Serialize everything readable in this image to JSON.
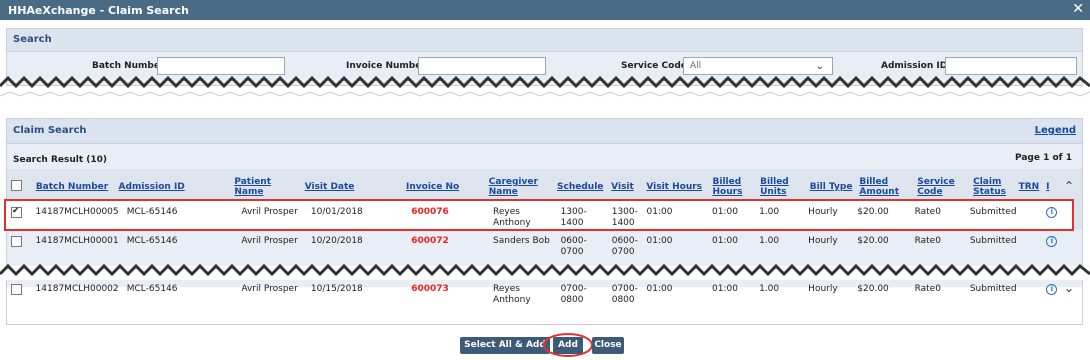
{
  "window": {
    "title": "HHAeXchange - Claim Search",
    "close_label": "✕"
  },
  "search_panel": {
    "title": "Search",
    "batch_label": "Batch Number:",
    "invoice_label": "Invoice Number:",
    "service_code_label": "Service Code:",
    "service_code_value": "All",
    "admission_label": "Admission ID:"
  },
  "results_panel": {
    "title": "Claim Search",
    "legend_link": "Legend",
    "result_count": "Search Result (10)",
    "page_info": "Page 1 of 1"
  },
  "columns": [
    "Batch Number",
    "Admission ID",
    "Patient Name",
    "Visit Date",
    "Invoice No",
    "Caregiver Name",
    "Schedule",
    "Visit",
    "Visit Hours",
    "Billed Hours",
    "Billed Units",
    "Bill Type",
    "Billed Amount",
    "Service Code",
    "Claim Status",
    "TRN",
    "I"
  ],
  "rows": [
    {
      "checked": true,
      "batch": "14187MCLH00005",
      "admission": "MCL-65146",
      "patient": "Avril Prosper",
      "date": "10/01/2018",
      "invoice": "600076",
      "caregiver": "Reyes Anthony",
      "schedule": "1300-1400",
      "visit": "1300-\n1400",
      "visit_hours": "01:00",
      "billed_hours": "01:00",
      "billed_units": "1.00",
      "bill_type": "Hourly",
      "amount": "$20.00",
      "service": "Rate0",
      "status": "Submitted"
    },
    {
      "checked": false,
      "batch": "14187MCLH00001",
      "admission": "MCL-65146",
      "patient": "Avril Prosper",
      "date": "10/20/2018",
      "invoice": "600072",
      "caregiver": "Sanders Bob",
      "schedule": "0600-0700",
      "visit": "0600-\n0700",
      "visit_hours": "01:00",
      "billed_hours": "01:00",
      "billed_units": "1.00",
      "bill_type": "Hourly",
      "amount": "$20.00",
      "service": "Rate0",
      "status": "Submitted"
    },
    {
      "checked": false,
      "batch": "14187MCLH00002",
      "admission": "MCL-65146",
      "patient": "Avril Prosper",
      "date": "10/15/2018",
      "invoice": "600073",
      "caregiver": "Reyes Anthony",
      "schedule": "0700-0800",
      "visit": "0700-\n0800",
      "visit_hours": "01:00",
      "billed_hours": "01:00",
      "billed_units": "1.00",
      "bill_type": "Hourly",
      "amount": "$20.00",
      "service": "Rate0",
      "status": "Submitted"
    }
  ],
  "buttons": {
    "select_all_add": "Select All & Add",
    "add": "Add",
    "close": "Close"
  },
  "colors": {
    "header": "#4a6b85",
    "panel": "#e9edf5",
    "highlight": "#e03030",
    "link": "#1a4aa0",
    "invoice_red": "#e22222"
  },
  "icons": {
    "close": "close-icon",
    "dropdown": "chevron-down-icon",
    "info": "info-icon",
    "scroll_up": "chevron-up-icon",
    "scroll_down": "chevron-down-icon"
  }
}
